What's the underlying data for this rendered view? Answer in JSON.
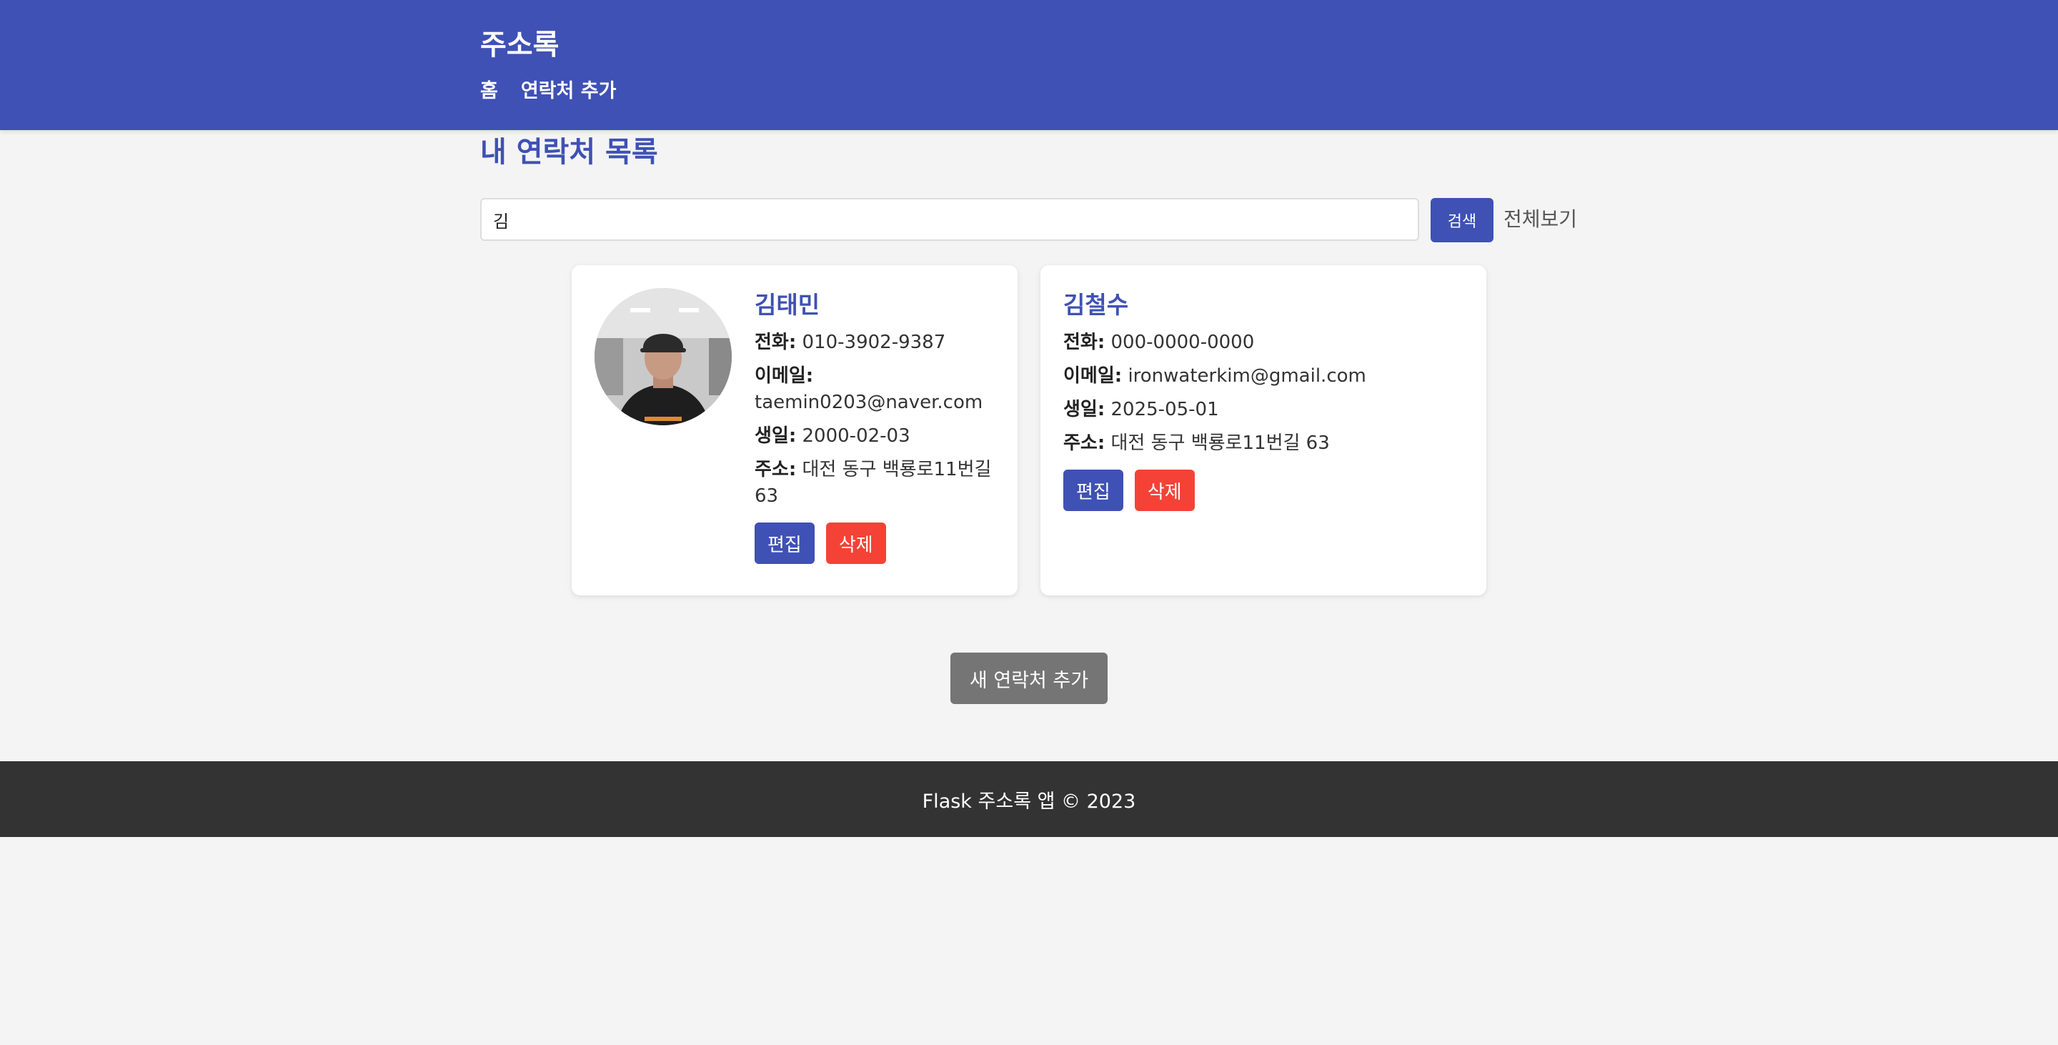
{
  "header": {
    "brand": "주소록",
    "nav": [
      {
        "label": "홈"
      },
      {
        "label": "연락처 추가"
      }
    ]
  },
  "page": {
    "title": "내 연락처 목록"
  },
  "search": {
    "value": "김",
    "button_label": "검색",
    "view_all_label": "전체보기"
  },
  "labels": {
    "phone": "전화:",
    "email": "이메일:",
    "birthday": "생일:",
    "address": "주소:",
    "edit": "편집",
    "delete": "삭제"
  },
  "contacts": [
    {
      "name": "김태민",
      "phone": "010-3902-9387",
      "email": "taemin0203@naver.com",
      "birthday": "2000-02-03",
      "address": "대전 동구 백룡로11번길 63",
      "has_photo": true
    },
    {
      "name": "김철수",
      "phone": "000-0000-0000",
      "email": "ironwaterkim@gmail.com",
      "birthday": "2025-05-01",
      "address": "대전 동구 백룡로11번길 63",
      "has_photo": false
    }
  ],
  "add_button_label": "새 연락처 추가",
  "footer": {
    "text": "Flask 주소록 앱 © 2023"
  },
  "colors": {
    "primary": "#3f51b5",
    "danger": "#f44336",
    "secondary": "#757575",
    "footer_bg": "#333333",
    "page_bg": "#f4f4f4"
  }
}
